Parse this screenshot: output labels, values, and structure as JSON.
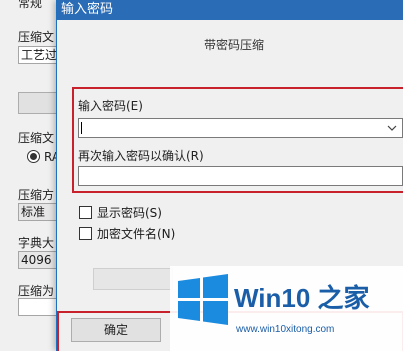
{
  "background_window": {
    "tab_label": "常规",
    "compress_file_label": "压缩文",
    "compress_file_value": "工艺过",
    "format_label": "压缩文",
    "format_option": "RA",
    "method_label": "压缩方",
    "method_value": "标准",
    "dict_label": "字典大",
    "dict_value": "4096 K",
    "split_label": "压缩为"
  },
  "dialog": {
    "title": "输入密码",
    "heading": "带密码压缩",
    "password_label": "输入密码(E)",
    "password_value": "",
    "confirm_label": "再次输入密码以确认(R)",
    "confirm_value": "",
    "show_password_label": "显示密码(S)",
    "show_password_checked": false,
    "encrypt_names_label": "加密文件名(N)",
    "encrypt_names_checked": false,
    "ok_label": "确定"
  },
  "watermark": {
    "brand": "Win10 之家",
    "url": "www.win10xitong.com"
  }
}
